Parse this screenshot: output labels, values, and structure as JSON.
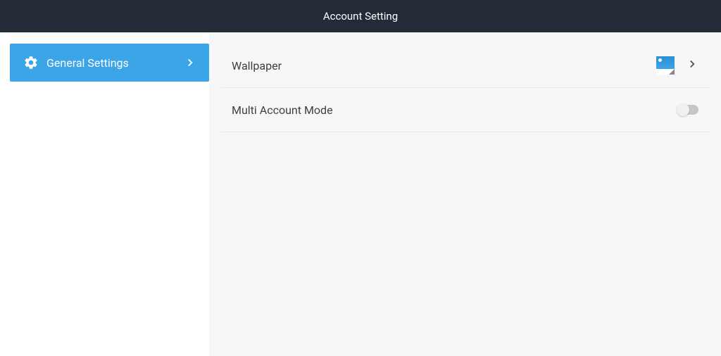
{
  "header": {
    "title": "Account Setting"
  },
  "sidebar": {
    "items": [
      {
        "label": "General Settings"
      }
    ]
  },
  "main": {
    "rows": {
      "wallpaper": {
        "label": "Wallpaper"
      },
      "multi_account": {
        "label": "Multi Account Mode",
        "enabled": false
      }
    }
  }
}
